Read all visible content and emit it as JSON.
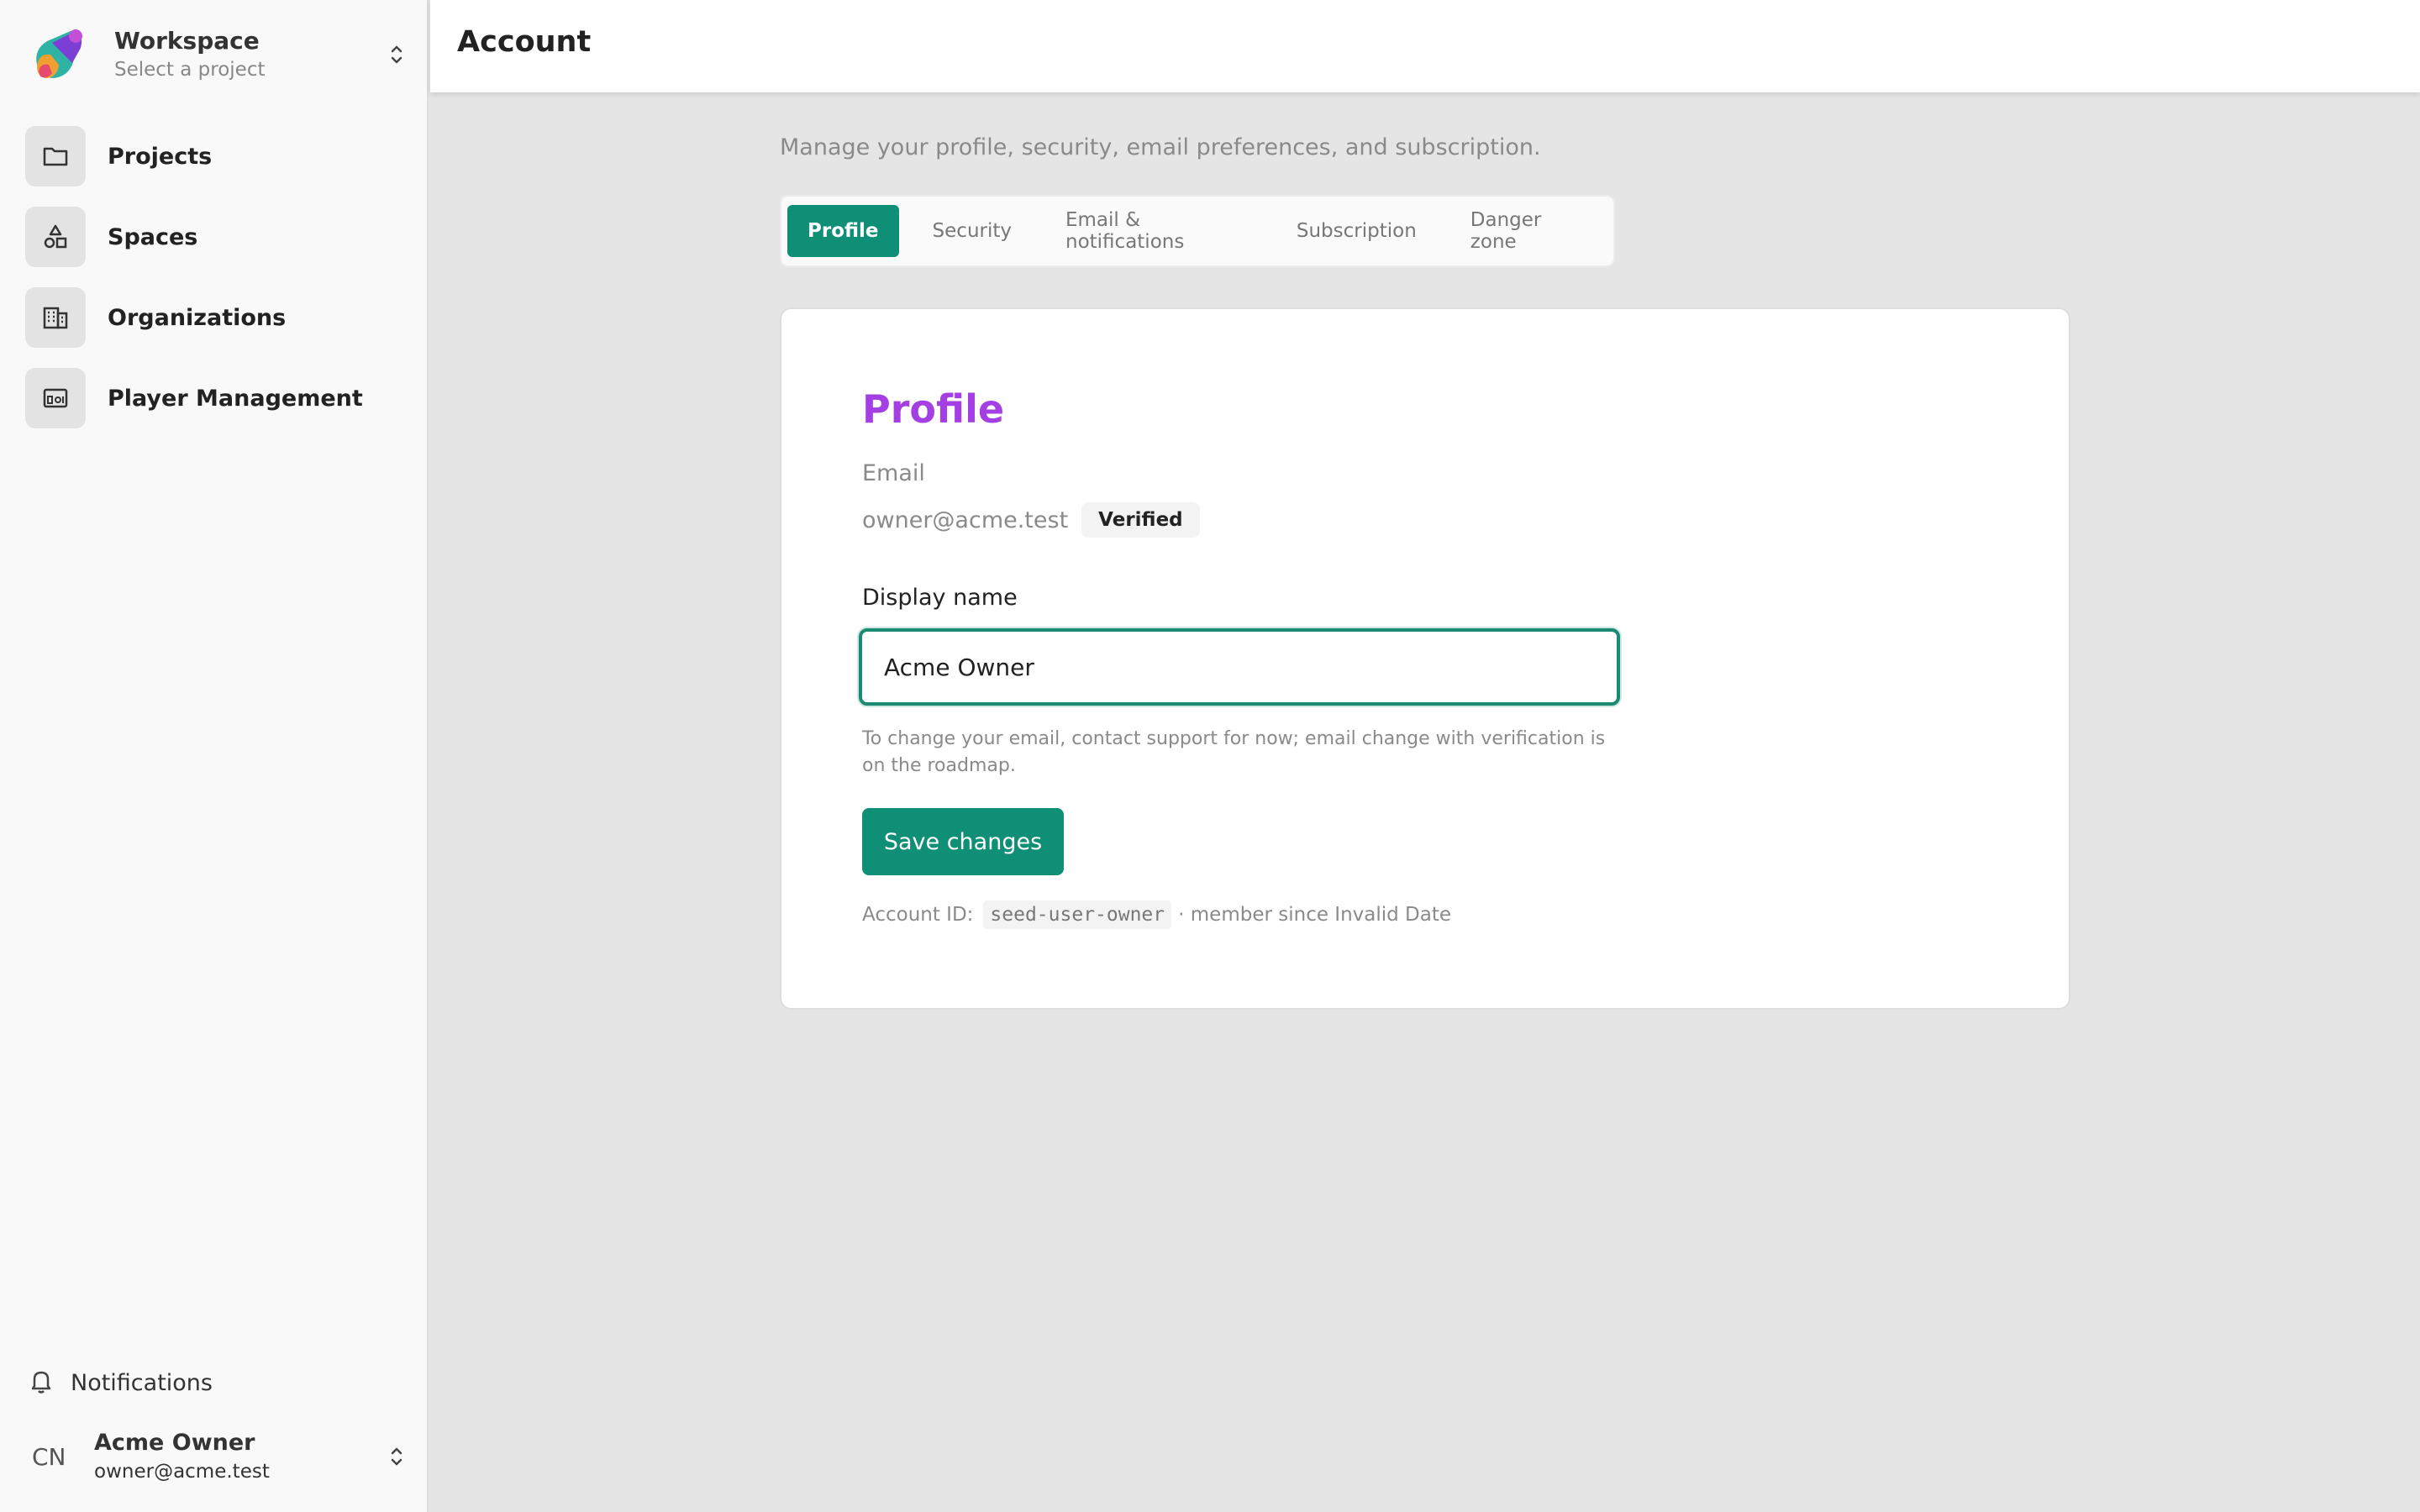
{
  "workspace": {
    "title": "Workspace",
    "subtitle": "Select a project"
  },
  "sidebar": {
    "items": [
      {
        "label": "Projects",
        "icon": "folder-icon"
      },
      {
        "label": "Spaces",
        "icon": "shapes-icon"
      },
      {
        "label": "Organizations",
        "icon": "building-icon"
      },
      {
        "label": "Player Management",
        "icon": "player-icon"
      }
    ],
    "notifications_label": "Notifications"
  },
  "user": {
    "initials": "CN",
    "name": "Acme Owner",
    "email": "owner@acme.test"
  },
  "header": {
    "title": "Account"
  },
  "main": {
    "subtitle": "Manage your profile, security, email preferences, and subscription.",
    "tabs": [
      {
        "label": "Profile",
        "active": true
      },
      {
        "label": "Security",
        "active": false
      },
      {
        "label": "Email & notifications",
        "active": false
      },
      {
        "label": "Subscription",
        "active": false
      },
      {
        "label": "Danger zone",
        "active": false
      }
    ]
  },
  "profile": {
    "title": "Profile",
    "email_label": "Email",
    "email_value": "owner@acme.test",
    "email_badge": "Verified",
    "display_name_label": "Display name",
    "display_name_value": "Acme Owner",
    "hint": "To change your email, contact support for now; email change with verification is on the roadmap.",
    "save_label": "Save changes",
    "account_id_label": "Account ID:",
    "account_id_value": "seed-user-owner",
    "member_since": "· member since Invalid Date"
  },
  "colors": {
    "accent": "#0f8f76",
    "title": "#a33fe3",
    "background": "#e5e5e5"
  }
}
